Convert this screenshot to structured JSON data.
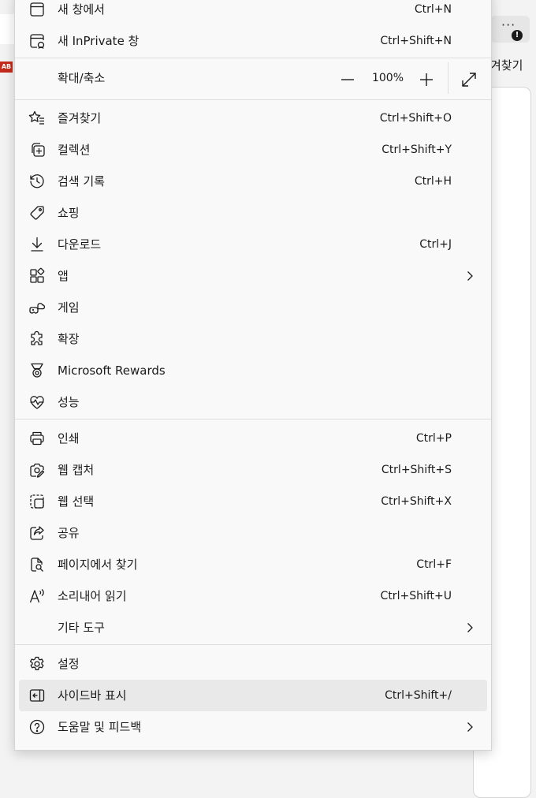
{
  "background": {
    "ab_badge": "AB",
    "more_dots": "···",
    "alert_mark": "!",
    "favorites_label": "겨찾기"
  },
  "menu": {
    "items": [
      {
        "label": "새 창에서",
        "shortcut": "Ctrl+N",
        "icon": "new-window-icon"
      },
      {
        "label": "새 InPrivate 창",
        "shortcut": "Ctrl+Shift+N",
        "icon": "inprivate-icon"
      },
      {
        "label": "즐겨찾기",
        "shortcut": "Ctrl+Shift+O",
        "icon": "favorites-icon"
      },
      {
        "label": "컬렉션",
        "shortcut": "Ctrl+Shift+Y",
        "icon": "collections-icon"
      },
      {
        "label": "검색 기록",
        "shortcut": "Ctrl+H",
        "icon": "history-icon"
      },
      {
        "label": "쇼핑",
        "shortcut": "",
        "icon": "shopping-tag-icon"
      },
      {
        "label": "다운로드",
        "shortcut": "Ctrl+J",
        "icon": "download-icon"
      },
      {
        "label": "앱",
        "shortcut": "",
        "icon": "apps-icon"
      },
      {
        "label": "게임",
        "shortcut": "",
        "icon": "games-icon"
      },
      {
        "label": "확장",
        "shortcut": "",
        "icon": "extensions-icon"
      },
      {
        "label": "Microsoft Rewards",
        "shortcut": "",
        "icon": "rewards-medal-icon"
      },
      {
        "label": "성능",
        "shortcut": "",
        "icon": "performance-heart-icon"
      },
      {
        "label": "인쇄",
        "shortcut": "Ctrl+P",
        "icon": "print-icon"
      },
      {
        "label": "웹 캡처",
        "shortcut": "Ctrl+Shift+S",
        "icon": "web-capture-icon"
      },
      {
        "label": "웹 선택",
        "shortcut": "Ctrl+Shift+X",
        "icon": "web-select-icon"
      },
      {
        "label": "공유",
        "shortcut": "",
        "icon": "share-icon"
      },
      {
        "label": "페이지에서 찾기",
        "shortcut": "Ctrl+F",
        "icon": "find-in-page-icon"
      },
      {
        "label": "소리내어 읽기",
        "shortcut": "Ctrl+Shift+U",
        "icon": "read-aloud-icon"
      },
      {
        "label": "기타 도구",
        "shortcut": "",
        "icon": ""
      },
      {
        "label": "설정",
        "shortcut": "",
        "icon": "settings-gear-icon"
      },
      {
        "label": "사이드바 표시",
        "shortcut": "Ctrl+Shift+/",
        "icon": "sidebar-icon"
      },
      {
        "label": "도움말 및 피드백",
        "shortcut": "",
        "icon": "help-icon"
      }
    ],
    "zoom": {
      "label": "확대/축소",
      "value": "100%",
      "minus_icon": "minus-icon",
      "plus_icon": "plus-icon",
      "fullscreen_icon": "fullscreen-icon"
    }
  },
  "colors": {
    "menu_bg": "#f9f9f9",
    "hover_bg": "#e9e9e9",
    "divider": "#dedede",
    "text": "#1b1b1b",
    "ab_badge_red": "#c42b1c"
  }
}
